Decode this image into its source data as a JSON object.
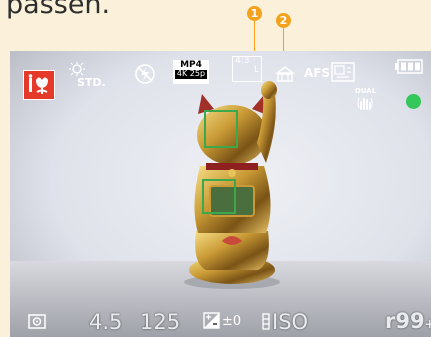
{
  "doc": {
    "heading_text": "passen."
  },
  "callouts": [
    {
      "number": "1"
    },
    {
      "number": "2"
    }
  ],
  "osd": {
    "scene_icon": "macro-flower-icon",
    "photo_style": "STD.",
    "flash_icon": "flash-off-icon",
    "video_format_top": "MP4",
    "video_format_bottom": "4K 25p",
    "aspect_ratio": "4:3",
    "image_size": "L",
    "quality_icon": "quality-fine-icon",
    "focus_mode": "AFS",
    "af_area_icon": "face-eye-detection-icon",
    "battery_icon": "battery-full-icon",
    "stabilizer_label": "DUAL",
    "stabilizer_icon": "stabilizer-hand-icon",
    "focus_indicator_color": "#34c759",
    "metering_icon": "metering-icon",
    "aperture": "4.5",
    "shutter_speed": "125",
    "exposure_comp_icon": "exposure-comp-icon",
    "exposure_comp": "±0",
    "iso_icon": "iso-icon",
    "iso": "ISO",
    "shots_remaining": "r99",
    "shots_suffix": "+"
  }
}
